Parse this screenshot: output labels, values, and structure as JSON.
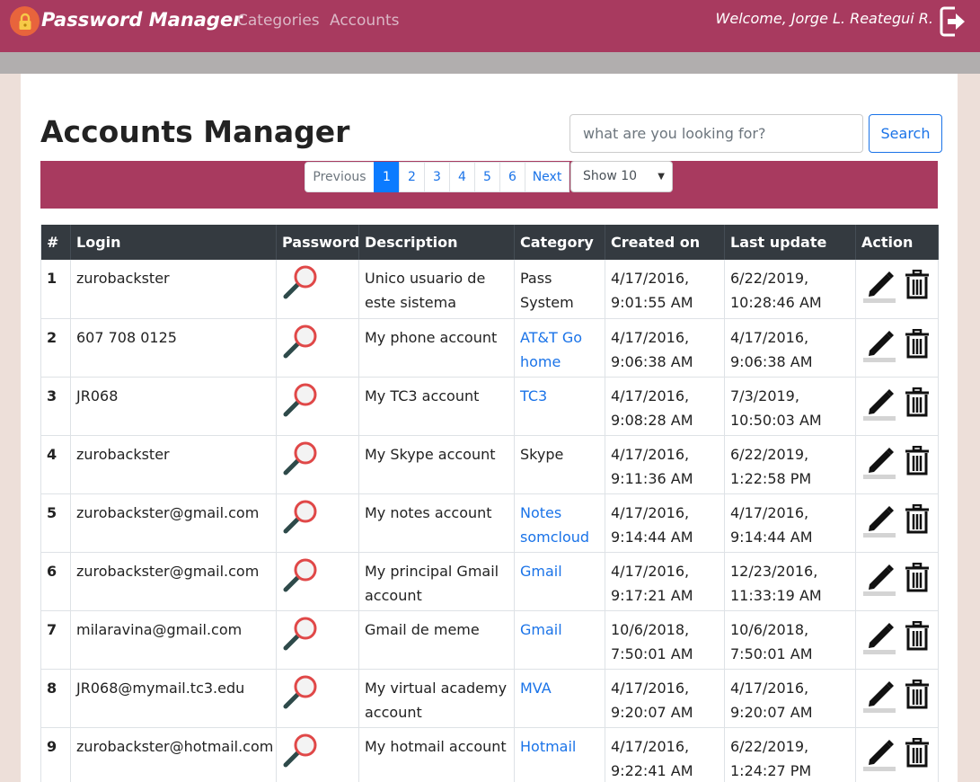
{
  "navbar": {
    "brand": "Password Manager",
    "links": [
      "Categories",
      "Accounts"
    ],
    "welcome": "Welcome, Jorge L. Reategui R.",
    "brand_icon": "lock-icon",
    "logout_icon": "sign-out-icon"
  },
  "colors": {
    "primary": "#a83a5f",
    "link": "#1a73e8",
    "header": "#343a40",
    "active_page": "#0b7bff"
  },
  "page": {
    "title": "Accounts Manager",
    "search_placeholder": "what are you looking for?",
    "search_button": "Search"
  },
  "pagination": {
    "previous": "Previous",
    "pages": [
      "1",
      "2",
      "3",
      "4",
      "5",
      "6"
    ],
    "active_page": "1",
    "next": "Next",
    "show": "Show 10"
  },
  "table": {
    "headers": [
      "#",
      "Login",
      "Password",
      "Description",
      "Category",
      "Created on",
      "Last update",
      "Action"
    ],
    "rows": [
      {
        "num": "1",
        "login": "zurobackster",
        "description": "Unico usuario de este sistema",
        "category": "Pass System",
        "category_link": false,
        "created": "4/17/2016, 9:01:55 AM",
        "updated": "6/22/2019, 10:28:46 AM"
      },
      {
        "num": "2",
        "login": "607 708 0125",
        "description": "My phone account",
        "category": "AT&T Go home",
        "category_link": true,
        "created": "4/17/2016, 9:06:38 AM",
        "updated": "4/17/2016, 9:06:38 AM"
      },
      {
        "num": "3",
        "login": "JR068",
        "description": "My TC3 account",
        "category": "TC3",
        "category_link": true,
        "created": "4/17/2016, 9:08:28 AM",
        "updated": "7/3/2019, 10:50:03 AM"
      },
      {
        "num": "4",
        "login": "zurobackster",
        "description": "My Skype account",
        "category": "Skype",
        "category_link": false,
        "created": "4/17/2016, 9:11:36 AM",
        "updated": "6/22/2019, 1:22:58 PM"
      },
      {
        "num": "5",
        "login": "zurobackster@gmail.com",
        "description": "My notes account",
        "category": "Notes somcloud",
        "category_link": true,
        "created": "4/17/2016, 9:14:44 AM",
        "updated": "4/17/2016, 9:14:44 AM"
      },
      {
        "num": "6",
        "login": "zurobackster@gmail.com",
        "description": "My principal Gmail account",
        "category": "Gmail",
        "category_link": true,
        "created": "4/17/2016, 9:17:21 AM",
        "updated": "12/23/2016, 11:33:19 AM"
      },
      {
        "num": "7",
        "login": "milaravina@gmail.com",
        "description": "Gmail de meme",
        "category": "Gmail",
        "category_link": true,
        "created": "10/6/2018, 7:50:01 AM",
        "updated": "10/6/2018, 7:50:01 AM"
      },
      {
        "num": "8",
        "login": "JR068@mymail.tc3.edu",
        "description": "My virtual academy account",
        "category": "MVA",
        "category_link": true,
        "created": "4/17/2016, 9:20:07 AM",
        "updated": "4/17/2016, 9:20:07 AM"
      },
      {
        "num": "9",
        "login": "zurobackster@hotmail.com",
        "description": "My hotmail account",
        "category": "Hotmail",
        "category_link": true,
        "created": "4/17/2016, 9:22:41 AM",
        "updated": "6/22/2019, 1:24:27 PM"
      }
    ],
    "password_icon": "magnifier-icon",
    "edit_icon": "pencil-icon",
    "delete_icon": "trash-icon"
  }
}
